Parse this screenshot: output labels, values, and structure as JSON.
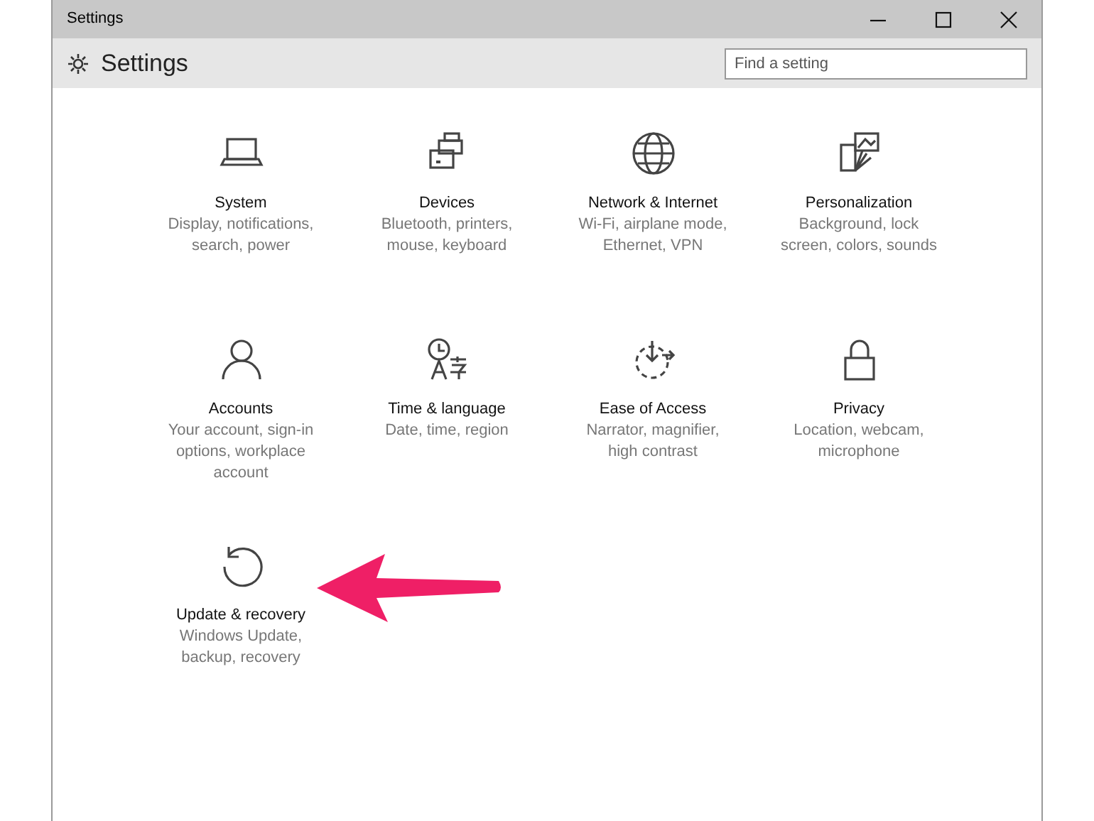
{
  "window": {
    "title": "Settings"
  },
  "header": {
    "title": "Settings",
    "search": {
      "placeholder": "Find a setting"
    }
  },
  "categories": [
    {
      "title": "System",
      "description": "Display, notifications, search, power"
    },
    {
      "title": "Devices",
      "description": "Bluetooth, printers, mouse, keyboard"
    },
    {
      "title": "Network & Internet",
      "description": "Wi-Fi, airplane mode, Ethernet, VPN"
    },
    {
      "title": "Personalization",
      "description": "Background, lock screen, colors, sounds"
    },
    {
      "title": "Accounts",
      "description": "Your account, sign-in options, workplace account"
    },
    {
      "title": "Time & language",
      "description": "Date, time, region"
    },
    {
      "title": "Ease of Access",
      "description": "Narrator, magnifier, high contrast"
    },
    {
      "title": "Privacy",
      "description": "Location, webcam, microphone"
    },
    {
      "title": "Update & recovery",
      "description": "Windows Update, backup, recovery"
    }
  ]
}
